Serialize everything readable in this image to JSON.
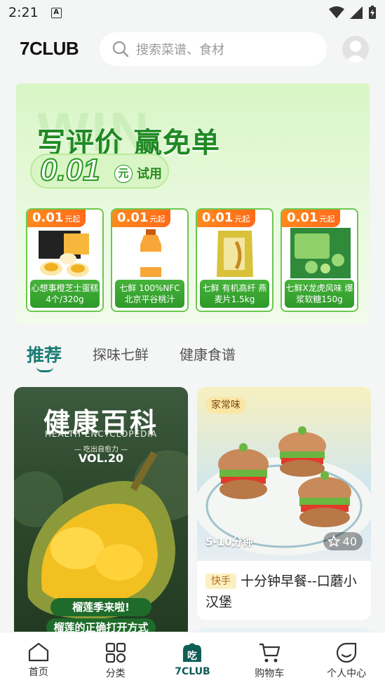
{
  "status_bar": {
    "time": "2:21",
    "notification_badge": "A"
  },
  "header": {
    "logo": "7CLUB",
    "search": {
      "placeholder": "搜索菜谱、食材"
    }
  },
  "banner": {
    "watermark": "WIN",
    "headline": "写评价 赢免单",
    "price": "0.01",
    "price_unit": "元",
    "price_suffix": "试用",
    "products": [
      {
        "price": "0.01",
        "suffix": "元起",
        "name": "心想事橙芝士蛋糕 4个/320g"
      },
      {
        "price": "0.01",
        "suffix": "元起",
        "name": "七鲜 100%NFC 北京平谷桃汁"
      },
      {
        "price": "0.01",
        "suffix": "元起",
        "name": "七鲜 有机高纤 燕麦片1.5kg"
      },
      {
        "price": "0.01",
        "suffix": "元起",
        "name": "七鲜X龙虎风味 爆浆软糖150g"
      }
    ]
  },
  "tabs": [
    {
      "label": "推荐",
      "active": true
    },
    {
      "label": "探味七鲜",
      "active": false
    },
    {
      "label": "健康食谱",
      "active": false
    }
  ],
  "feed": {
    "left_card": {
      "title": "健康百科",
      "subtitle": "HEALTH ENCYCLOPEDIA",
      "tagline": "— 吃出自愈力 —",
      "volume": "VOL.20",
      "line1": "榴莲季来啦!",
      "line2": "榴莲的正确打开方式"
    },
    "right_card": {
      "badge": "家常味",
      "duration": "5-10分钟",
      "favorites": "40",
      "tag": "快手",
      "title": "十分钟早餐--口蘑小汉堡"
    }
  },
  "bottom_nav": [
    {
      "label": "首页",
      "icon": "home-icon"
    },
    {
      "label": "分类",
      "icon": "category-icon"
    },
    {
      "label": "7CLUB",
      "icon": "eat-icon",
      "glyph": "吃",
      "active": true
    },
    {
      "label": "购物车",
      "icon": "cart-icon"
    },
    {
      "label": "个人中心",
      "icon": "profile-icon"
    }
  ],
  "colors": {
    "accent": "#1a7d74",
    "banner_green": "#2a9a20",
    "price_orange": "#ff7a1c"
  }
}
